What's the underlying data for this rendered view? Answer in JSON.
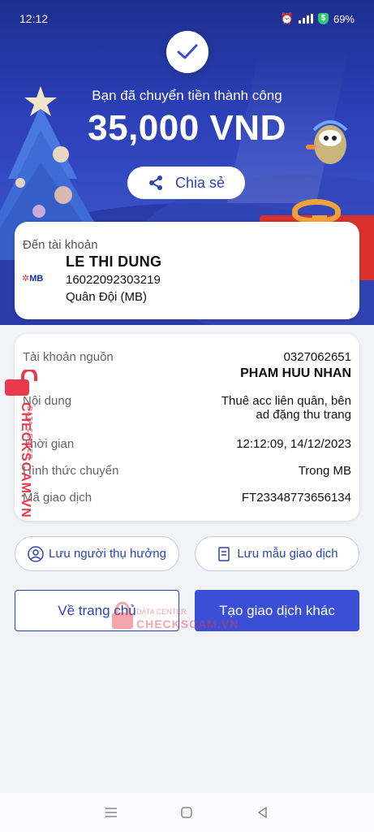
{
  "status_bar": {
    "time": "12:12",
    "battery": "69%"
  },
  "header": {
    "success_text": "Bạn đã chuyển tiền thành công",
    "amount": "35,000 VND",
    "share_label": "Chia sẻ"
  },
  "recipient": {
    "label": "Đến tài khoản",
    "bank_logo_text": "MB",
    "name": "LE THI DUNG",
    "account_number": "16022092303219",
    "bank_name": "Quân Đội (MB)"
  },
  "details": {
    "source_label": "Tài khoản nguồn",
    "source_account": "0327062651",
    "source_name": "PHAM HUU NHAN",
    "content_label": "Nội dung",
    "content_value_line1": "Thuê acc liên quân, bên",
    "content_value_line2": "ad đặng thu trang",
    "time_label": "Thời gian",
    "time_value": "12:12:09, 14/12/2023",
    "method_label": "Hình thức chuyển",
    "method_value": "Trong MB",
    "txn_label": "Mã giao dịch",
    "txn_value": "FT23348773656134"
  },
  "actions": {
    "save_beneficiary": "Lưu người thụ hưởng",
    "save_template": "Lưu mẫu giao dịch",
    "home": "Về trang chủ",
    "new_txn": "Tạo giao dịch khác"
  },
  "watermark": {
    "side_text": "CHECKSCAM.VN",
    "side_sub": "DATA CENTER",
    "mid_sub": "DATA CENTER",
    "mid_text": "CHECKSCAM.VN"
  },
  "colors": {
    "primary": "#3a4fd6",
    "accent_red": "#e83a4a",
    "success_green": "#2ecc71"
  }
}
